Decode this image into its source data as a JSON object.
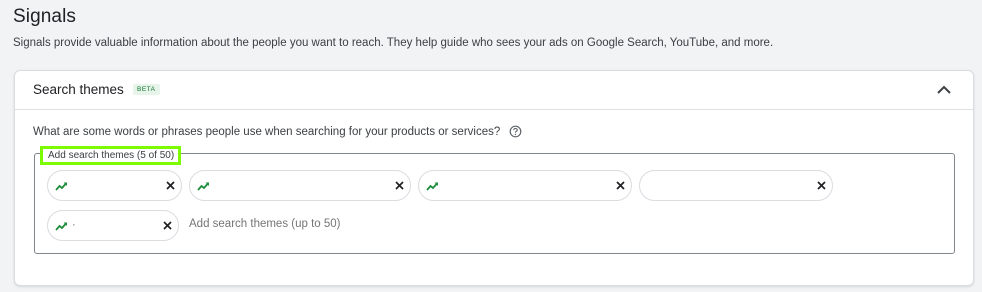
{
  "signals": {
    "title": "Signals",
    "description": "Signals provide valuable information about the people you want to reach. They help guide who sees your ads on Google Search, YouTube, and more."
  },
  "search_themes": {
    "title": "Search themes",
    "badge": "BETA",
    "question": "What are some words or phrases people use when searching for your products or services?",
    "field_label": "Add search themes (5 of 50)",
    "chips": [
      {
        "text": "",
        "trending": true
      },
      {
        "text": "",
        "trending": true
      },
      {
        "text": "",
        "trending": true
      },
      {
        "text": "",
        "trending": false
      },
      {
        "text": "·",
        "trending": true
      }
    ],
    "input_placeholder": "Add search themes (up to 50)"
  },
  "colors": {
    "accent_green": "#1e8e3e",
    "highlight": "#7cfc00",
    "badge_bg": "#e6f4ea"
  }
}
